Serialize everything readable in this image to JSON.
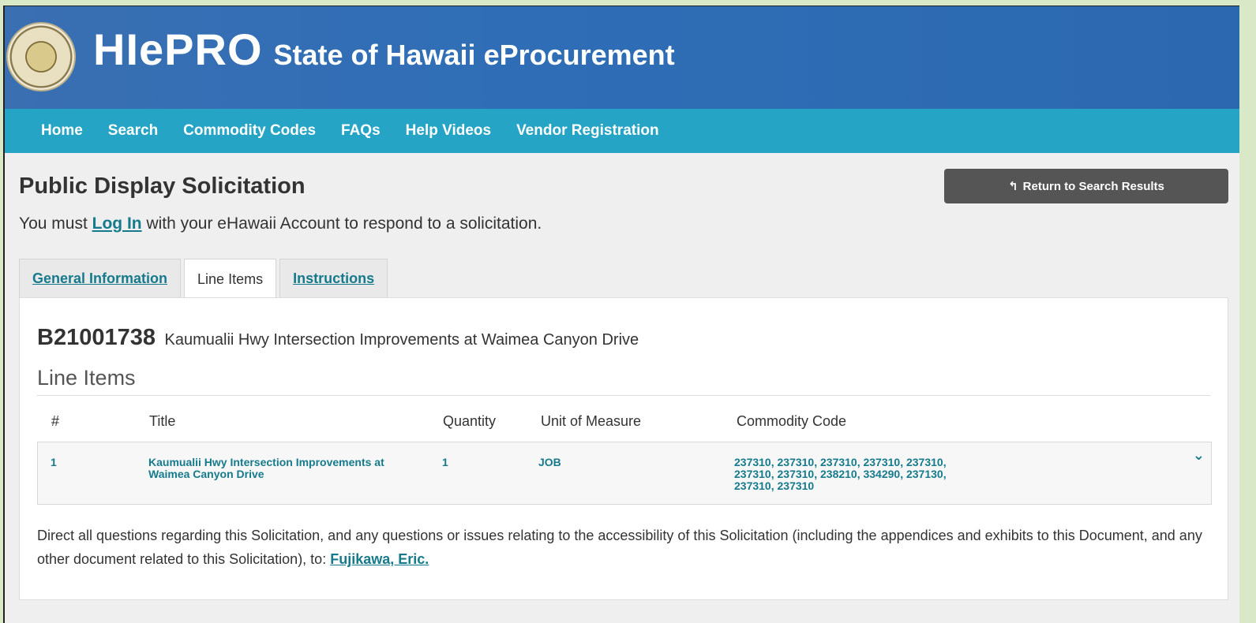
{
  "header": {
    "logo": "HIePRO",
    "subtitle": "State of Hawaii eProcurement"
  },
  "nav": {
    "items": [
      "Home",
      "Search",
      "Commodity Codes",
      "FAQs",
      "Help Videos",
      "Vendor Registration"
    ]
  },
  "page": {
    "title": "Public Display Solicitation",
    "login_prefix": "You must ",
    "login_link": "Log In",
    "login_suffix": " with your eHawaii Account to respond to a solicitation.",
    "return_button": "Return to Search Results"
  },
  "tabs": [
    {
      "label": "General Information",
      "active": false
    },
    {
      "label": "Line Items",
      "active": true
    },
    {
      "label": "Instructions",
      "active": false
    }
  ],
  "solicitation": {
    "number": "B21001738",
    "name": "Kaumualii Hwy Intersection Improvements at Waimea Canyon Drive"
  },
  "line_items": {
    "section_title": "Line Items",
    "columns": [
      "#",
      "Title",
      "Quantity",
      "Unit of Measure",
      "Commodity Code"
    ],
    "rows": [
      {
        "num": "1",
        "title": "Kaumualii Hwy Intersection Improvements at Waimea Canyon Drive",
        "quantity": "1",
        "unit": "JOB",
        "codes": "237310, 237310, 237310, 237310, 237310, 237310, 237310, 238210, 334290, 237130, 237310, 237310"
      }
    ]
  },
  "contact": {
    "text": "Direct all questions regarding this Solicitation, and any questions or issues relating to the accessibility of this Solicitation (including the appendices and exhibits to this Document, and any other document related to this Solicitation), to: ",
    "name": "Fujikawa, Eric."
  }
}
